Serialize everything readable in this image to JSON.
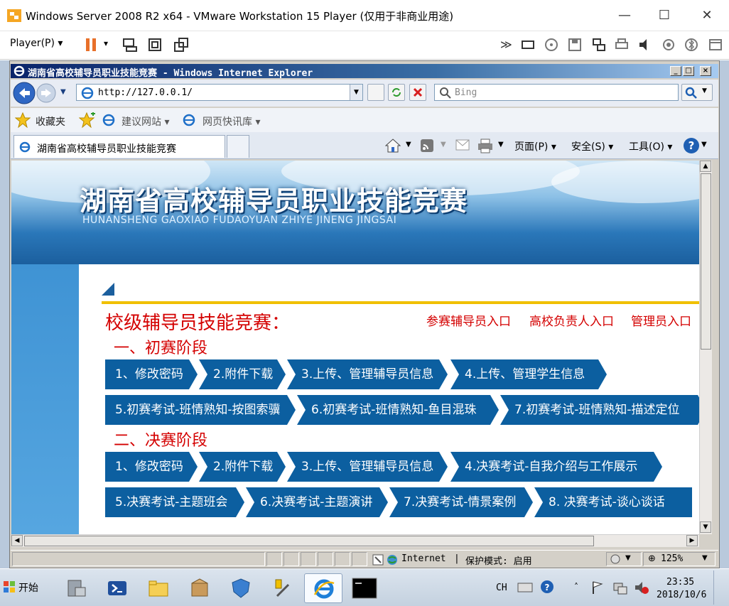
{
  "vm": {
    "title": "Windows Server 2008 R2 x64 - VMware Workstation 15 Player (仅用于非商业用途)",
    "player_menu": "Player(P)",
    "minimize": "—",
    "maximize": "☐",
    "close": "✕"
  },
  "ie": {
    "window_title": "湖南省高校辅导员职业技能竞赛 - Windows Internet Explorer",
    "address": "http://127.0.0.1/",
    "search_placeholder": "Bing",
    "favorites_label": "收藏夹",
    "fav_items": [
      "建议网站 ▾",
      "网页快讯库 ▾"
    ],
    "tab_title": "湖南省高校辅导员职业技能竞赛",
    "commands": [
      "页面(P) ▾",
      "安全(S) ▾",
      "工具(O) ▾"
    ]
  },
  "page": {
    "banner_title": "湖南省高校辅导员职业技能竞赛",
    "banner_subtitle": "HUNANSHENG GAOXIAO FUDAOYUAN ZHIYE JINENG JINGSAI",
    "section_title": "校级辅导员技能竞赛：",
    "links": [
      "参赛辅导员入口",
      "高校负责人入口",
      "管理员入口"
    ],
    "stage1_title": "一、初赛阶段",
    "stage1_row1": [
      "1、修改密码",
      "2.附件下载",
      "3.上传、管理辅导员信息",
      "4.上传、管理学生信息"
    ],
    "stage1_row2": [
      "5.初赛考试-班情熟知-按图索骥",
      "6.初赛考试-班情熟知-鱼目混珠",
      "7.初赛考试-班情熟知-描述定位"
    ],
    "stage2_title": "二、决赛阶段",
    "stage2_row1": [
      "1、修改密码",
      "2.附件下载",
      "3.上传、管理辅导员信息",
      "4.决赛考试-自我介绍与工作展示"
    ],
    "stage2_row2": [
      "5.决赛考试-主题班会",
      "6.决赛考试-主题演讲",
      "7.决赛考试-情景案例",
      "8. 决赛考试-谈心谈话"
    ]
  },
  "status": {
    "zone": "Internet",
    "protected_mode": "保护模式: 启用",
    "zoom": "125%"
  },
  "taskbar": {
    "start_label": "开始",
    "lang": "CH",
    "time": "23:35",
    "date": "2018/10/6"
  },
  "colors": {
    "button_blue": "#0c5fa0",
    "heading_red": "#d40000",
    "accent_yellow": "#f0c000"
  }
}
